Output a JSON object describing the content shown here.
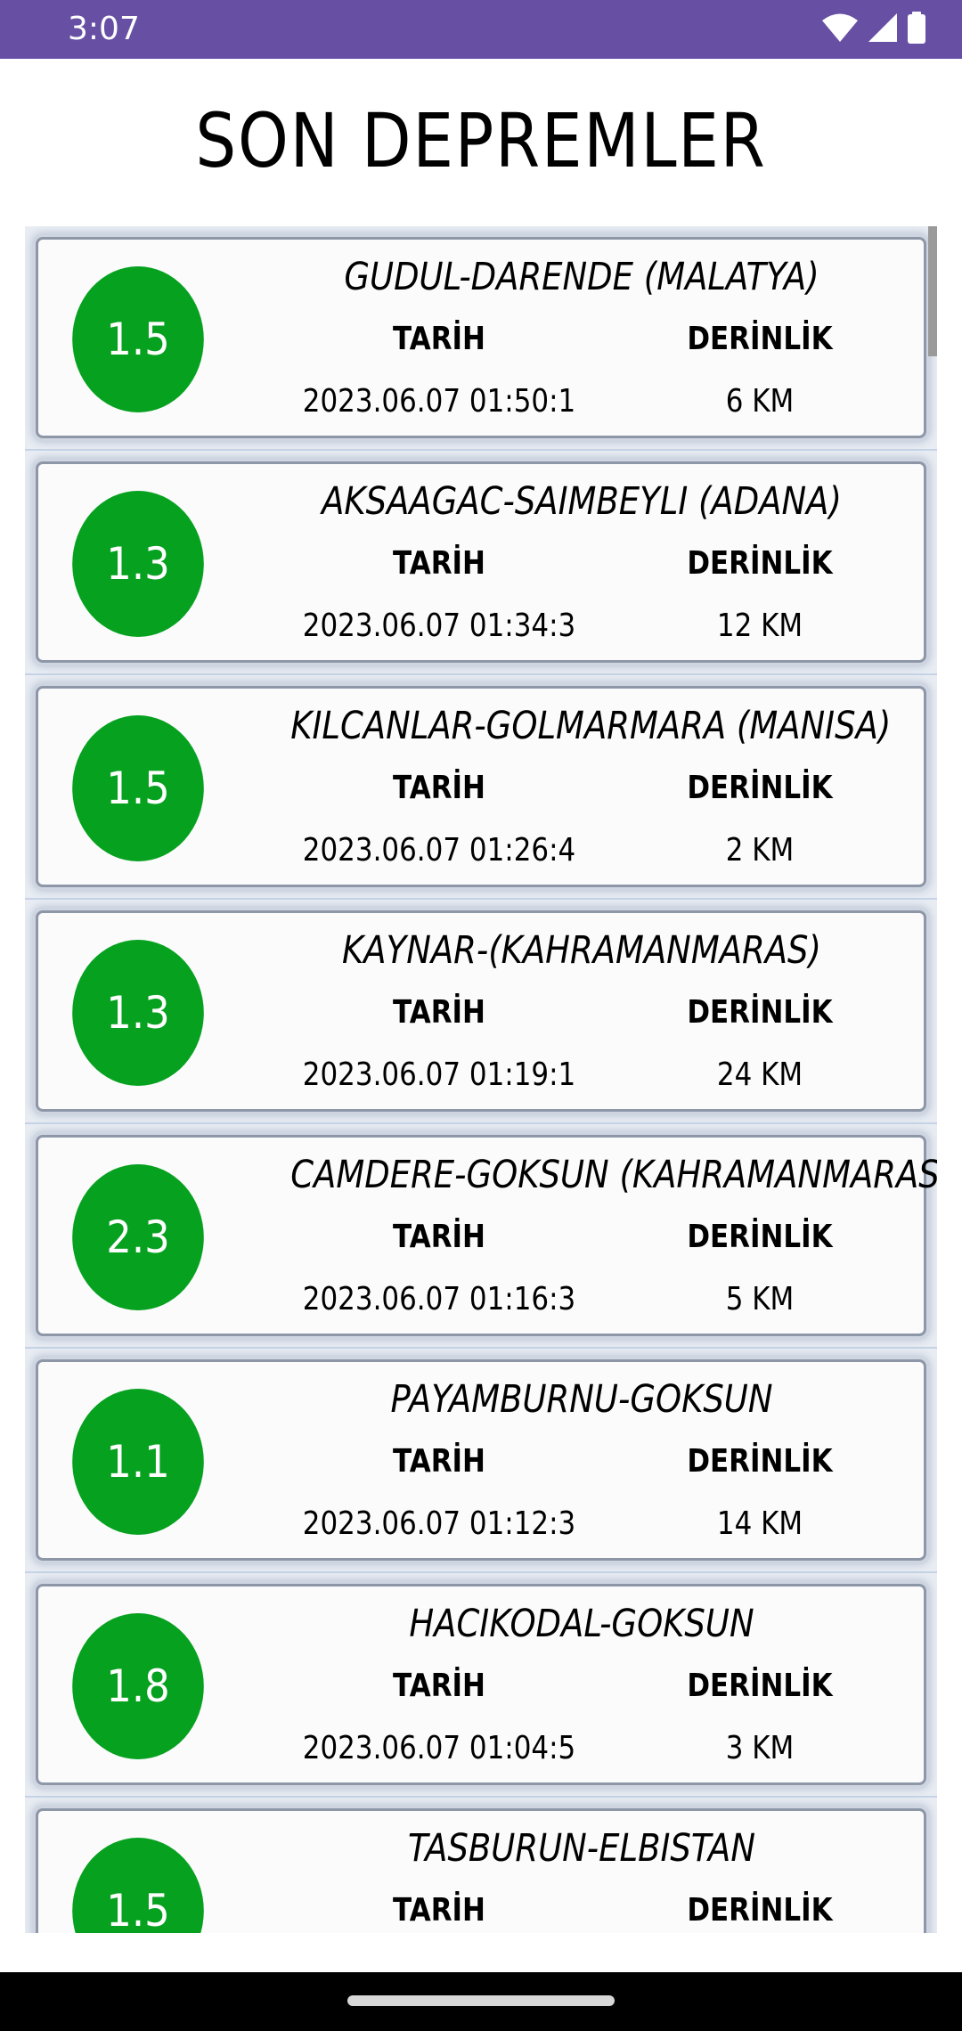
{
  "status_bar": {
    "time": "3:07",
    "icons": [
      "wifi-icon",
      "signal-icon",
      "battery-icon"
    ],
    "color": "#6750A4"
  },
  "page": {
    "title": "SON DEPREMLER"
  },
  "colors": {
    "magnitude_circle": "#06A11F",
    "card_border": "#8D97A8"
  },
  "earthquakes": [
    {
      "magnitude": "1.5",
      "location": "GUDUL-DARENDE (MALATYA)",
      "date_label": "TARİH",
      "depth_label": "DERİNLİK",
      "date": "2023.06.07 01:50:1",
      "depth": "6 KM"
    },
    {
      "magnitude": "1.3",
      "location": "AKSAAGAC-SAIMBEYLI (ADANA)",
      "date_label": "TARİH",
      "depth_label": "DERİNLİK",
      "date": "2023.06.07 01:34:3",
      "depth": "12 KM"
    },
    {
      "magnitude": "1.5",
      "location": "KILCANLAR-GOLMARMARA (MANISA)",
      "date_label": "TARİH",
      "depth_label": "DERİNLİK",
      "date": "2023.06.07 01:26:4",
      "depth": "2 KM"
    },
    {
      "magnitude": "1.3",
      "location": "KAYNAR-(KAHRAMANMARAS)",
      "date_label": "TARİH",
      "depth_label": "DERİNLİK",
      "date": "2023.06.07 01:19:1",
      "depth": "24 KM"
    },
    {
      "magnitude": "2.3",
      "location": "CAMDERE-GOKSUN (KAHRAMANMARAS)",
      "date_label": "TARİH",
      "depth_label": "DERİNLİK",
      "date": "2023.06.07 01:16:3",
      "depth": "5 KM"
    },
    {
      "magnitude": "1.1",
      "location": "PAYAMBURNU-GOKSUN",
      "date_label": "TARİH",
      "depth_label": "DERİNLİK",
      "date": "2023.06.07 01:12:3",
      "depth": "14 KM"
    },
    {
      "magnitude": "1.8",
      "location": "HACIKODAL-GOKSUN",
      "date_label": "TARİH",
      "depth_label": "DERİNLİK",
      "date": "2023.06.07 01:04:5",
      "depth": "3 KM"
    },
    {
      "magnitude": "1.5",
      "location": "TASBURUN-ELBISTAN",
      "date_label": "TARİH",
      "depth_label": "DERİNLİK",
      "date": "",
      "depth": ""
    }
  ]
}
